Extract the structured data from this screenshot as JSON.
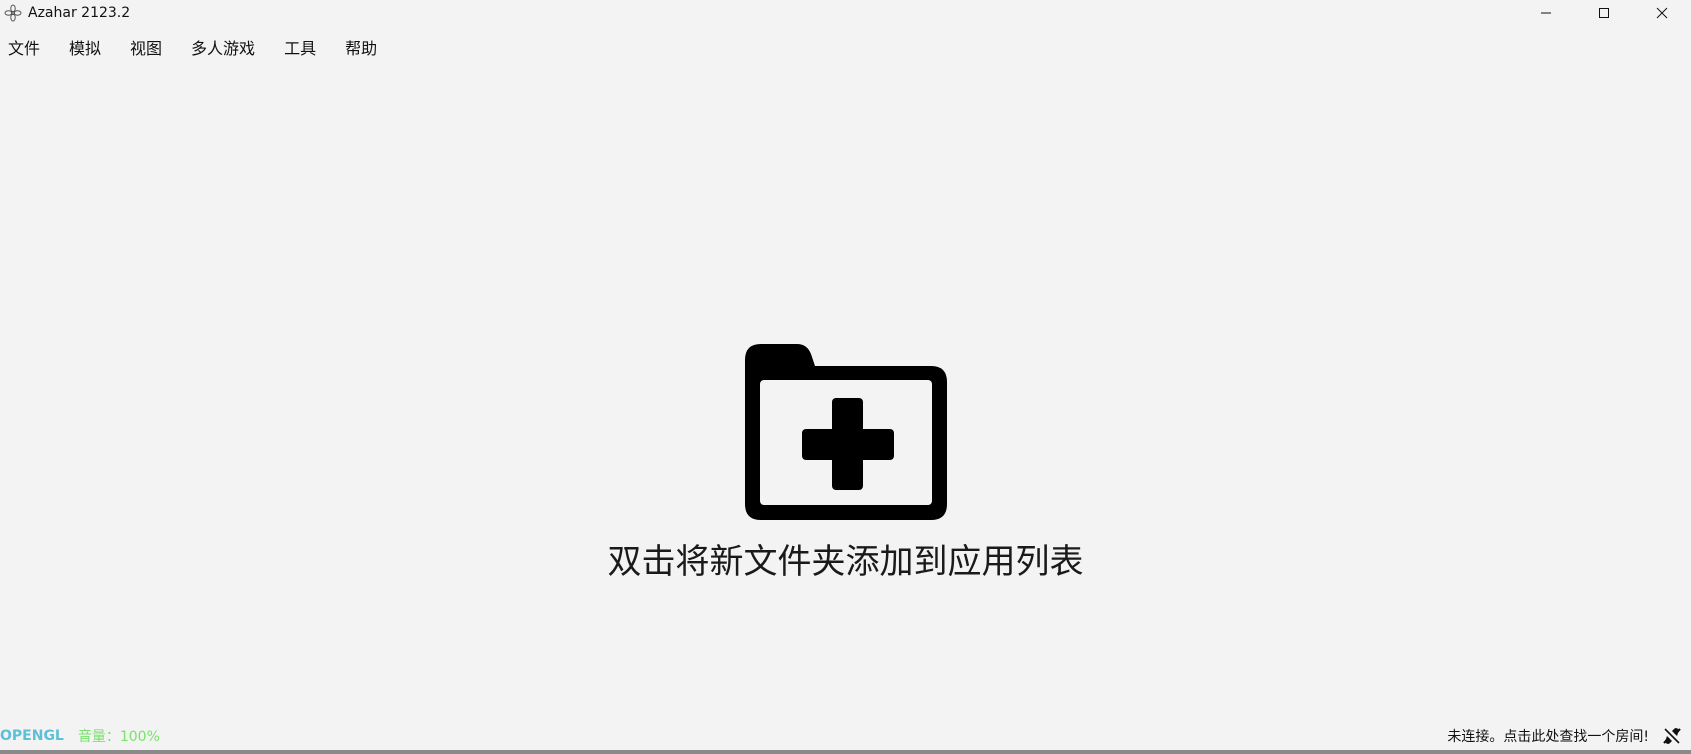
{
  "window": {
    "title": "Azahar 2123.2",
    "app_icon": "flower-logo-icon",
    "controls": {
      "minimize_icon": "minimize-icon",
      "maximize_icon": "maximize-icon",
      "close_icon": "close-icon"
    }
  },
  "menubar": {
    "items": [
      {
        "label": "文件"
      },
      {
        "label": "模拟"
      },
      {
        "label": "视图"
      },
      {
        "label": "多人游戏"
      },
      {
        "label": "工具"
      },
      {
        "label": "帮助"
      }
    ]
  },
  "main": {
    "empty_state": {
      "icon": "folder-add-icon",
      "text": "双击将新文件夹添加到应用列表"
    }
  },
  "statusbar": {
    "renderer": "OPENGL",
    "renderer_color": "#5bc0d8",
    "volume": "音量：100%",
    "volume_color": "#77e36a",
    "network_status": "未连接。点击此处查找一个房间!",
    "network_icon": "network-disconnected-icon"
  }
}
